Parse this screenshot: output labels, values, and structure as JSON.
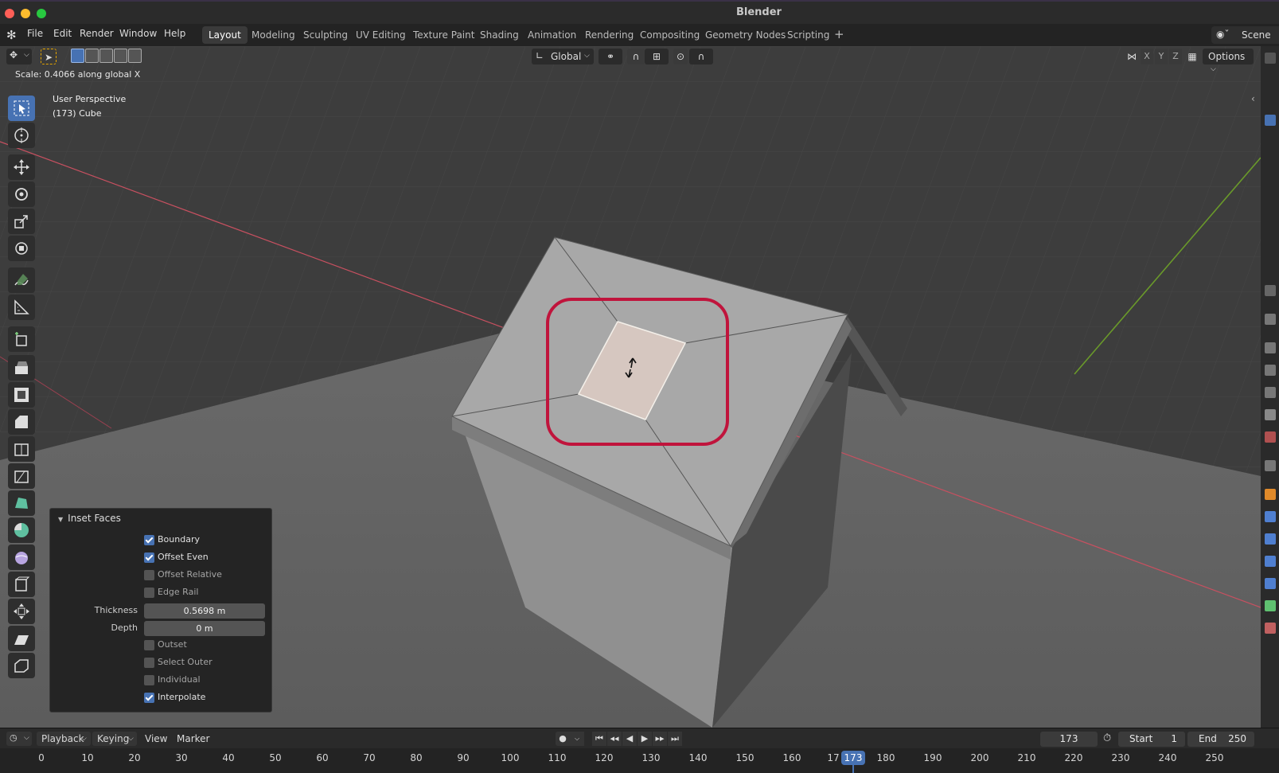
{
  "window": {
    "title": "Blender"
  },
  "menu": {
    "file": "File",
    "edit": "Edit",
    "render": "Render",
    "window": "Window",
    "help": "Help"
  },
  "workspaces": [
    "Layout",
    "Modeling",
    "Sculpting",
    "UV Editing",
    "Texture Paint",
    "Shading",
    "Animation",
    "Rendering",
    "Compositing",
    "Geometry Nodes",
    "Scripting"
  ],
  "active_workspace": "Layout",
  "scene": {
    "label": "Scene"
  },
  "viewport": {
    "status": "Scale: 0.4066 along global X",
    "perspective": "User Perspective",
    "object": "(173) Cube",
    "orientation": "Global",
    "axes": [
      "X",
      "Y",
      "Z"
    ],
    "options_label": "Options"
  },
  "operator_panel": {
    "title": "Inset Faces",
    "boundary": {
      "label": "Boundary",
      "checked": true
    },
    "offset_even": {
      "label": "Offset Even",
      "checked": true
    },
    "offset_relative": {
      "label": "Offset Relative",
      "checked": false
    },
    "edge_rail": {
      "label": "Edge Rail",
      "checked": false
    },
    "thickness": {
      "label": "Thickness",
      "value": "0.5698 m"
    },
    "depth": {
      "label": "Depth",
      "value": "0 m"
    },
    "outset": {
      "label": "Outset",
      "checked": false
    },
    "select_outer": {
      "label": "Select Outer",
      "checked": false
    },
    "individual": {
      "label": "Individual",
      "checked": false
    },
    "interpolate": {
      "label": "Interpolate",
      "checked": true
    }
  },
  "timeline": {
    "playback": "Playback",
    "keying": "Keying",
    "view": "View",
    "marker": "Marker",
    "current_frame": "173",
    "start_label": "Start",
    "start_value": "1",
    "end_label": "End",
    "end_value": "250",
    "ticks": [
      "0",
      "10",
      "20",
      "30",
      "40",
      "50",
      "60",
      "70",
      "80",
      "90",
      "100",
      "110",
      "120",
      "130",
      "140",
      "150",
      "160",
      "17",
      "180",
      "190",
      "200",
      "210",
      "220",
      "230",
      "240",
      "250"
    ],
    "current_badge": "173"
  },
  "colors": {
    "accent": "#4772b3",
    "highlight": "#c0143c",
    "selected_face": "#d6c7c0"
  }
}
